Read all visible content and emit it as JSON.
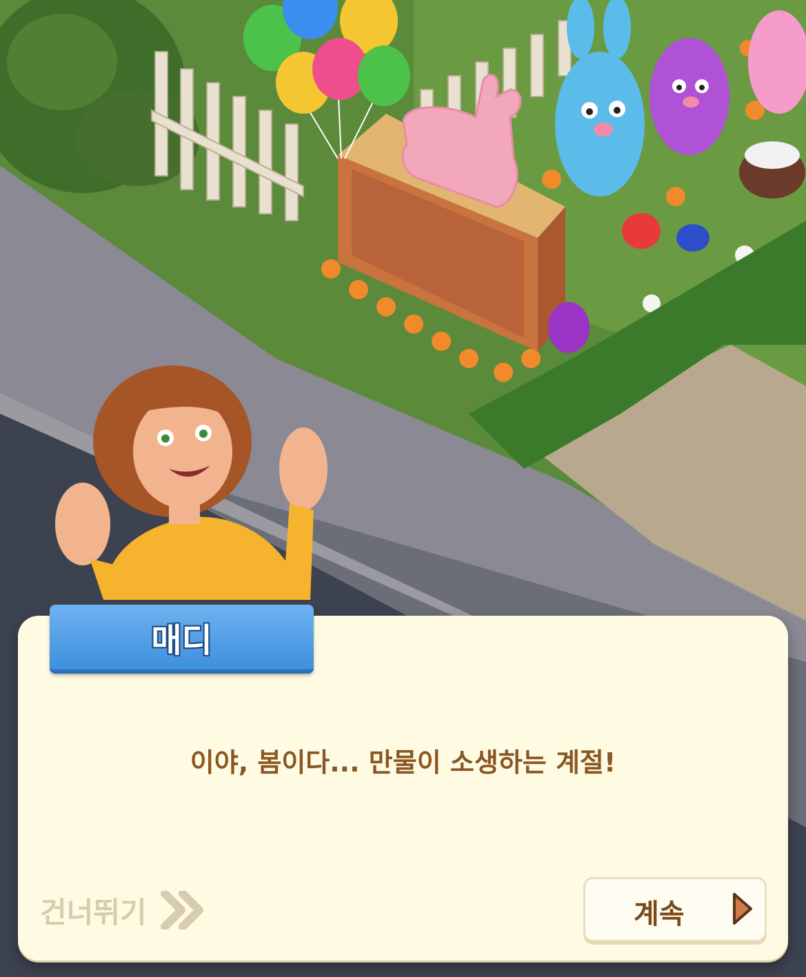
{
  "dialog": {
    "speaker": "매디",
    "message": "이야, 봄이다... 만물이 소생하는 계절!"
  },
  "controls": {
    "skip_label": "건너뛰기",
    "continue_label": "계속"
  },
  "colors": {
    "dialog_bg": "#fffbe3",
    "nameplate": "#4a9ce6",
    "message_text": "#8a5724",
    "skip_text": "#d8ccaf",
    "continue_text": "#7a4a18"
  }
}
